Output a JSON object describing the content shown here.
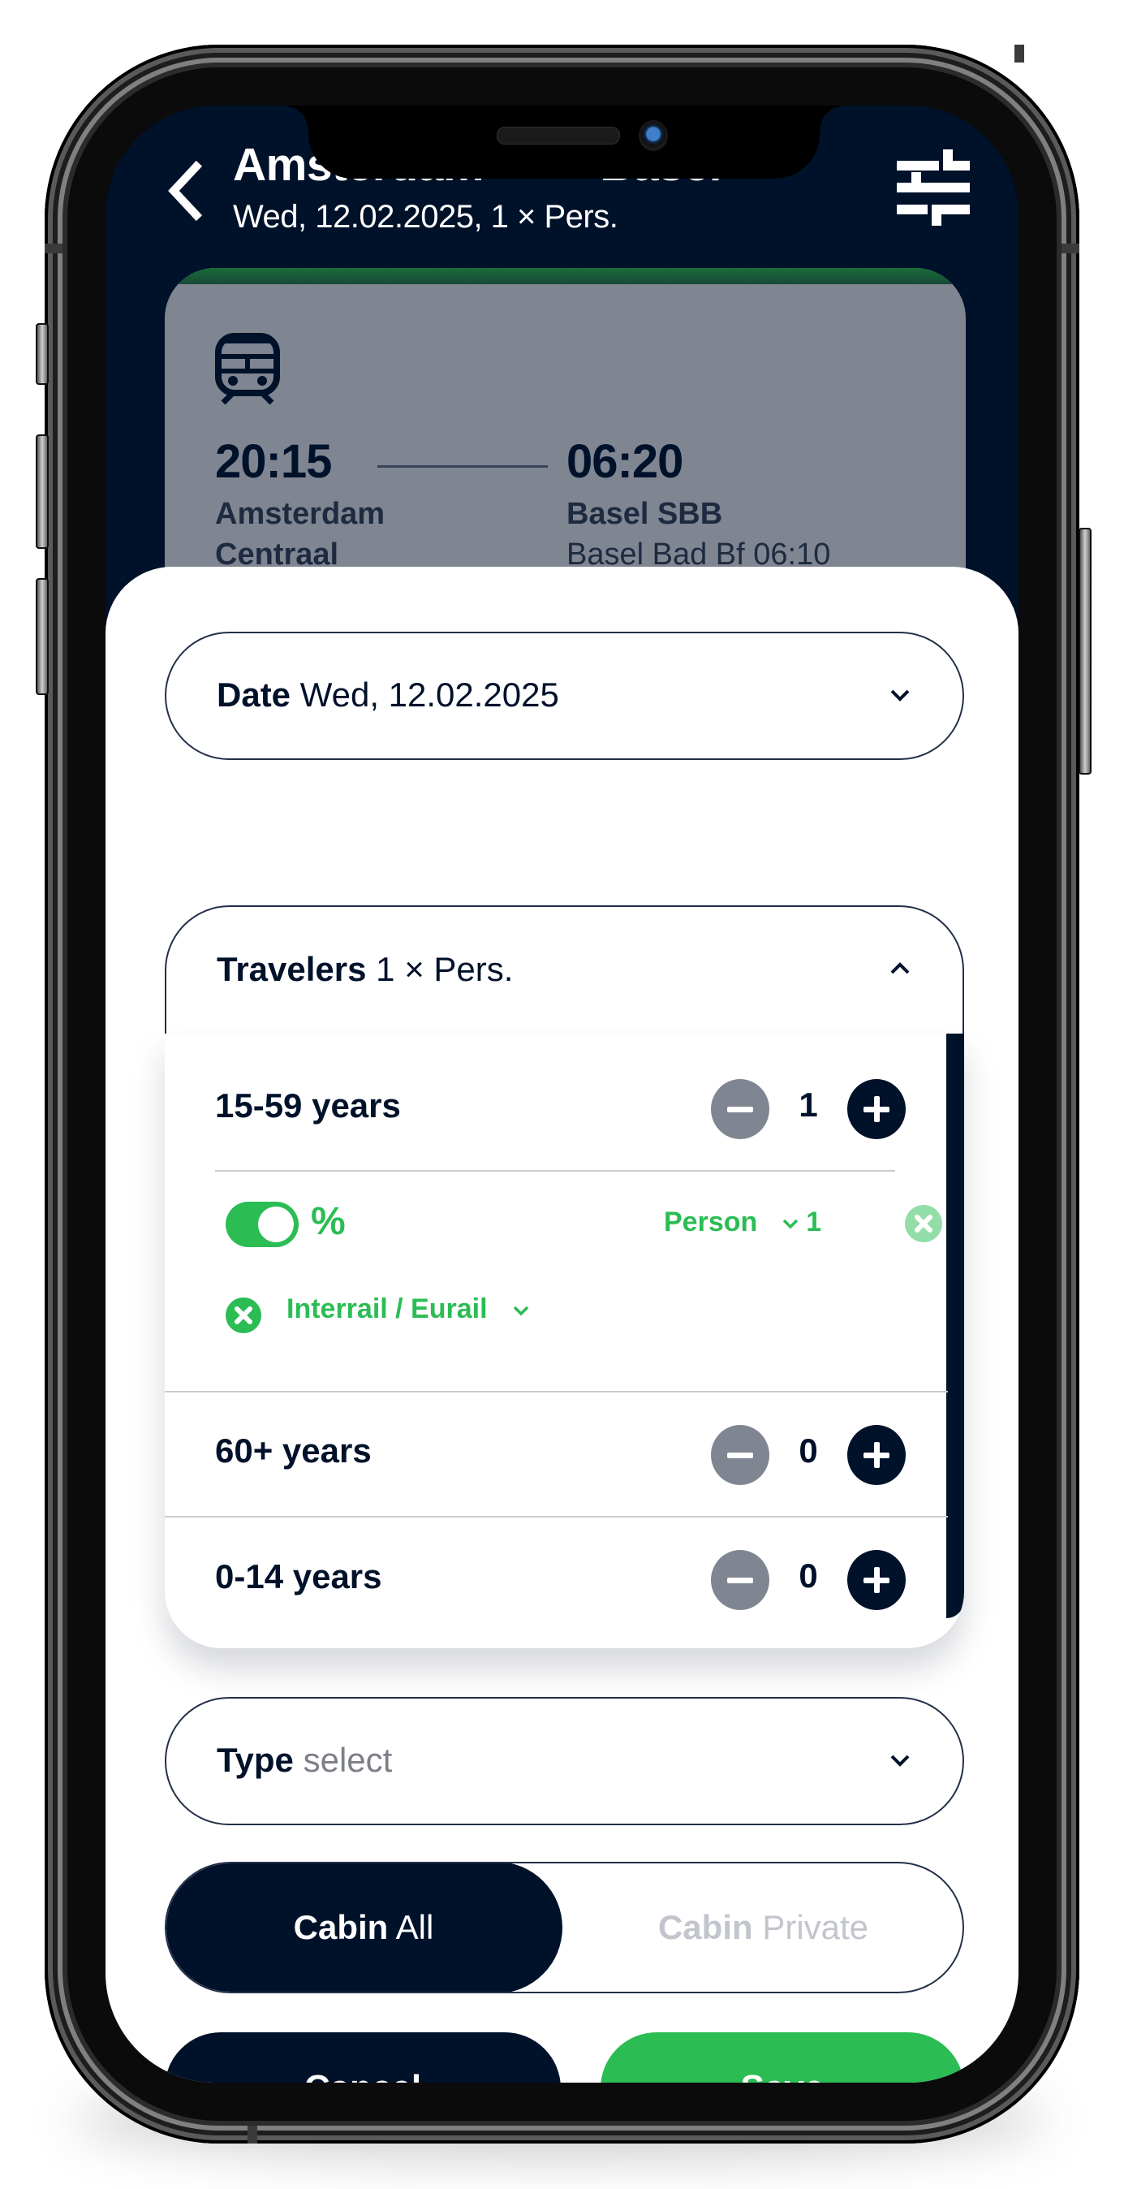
{
  "header": {
    "title_from": "Amsterdam",
    "title_arrow": "→",
    "title_to": "Basel",
    "subtitle": "Wed, 12.02.2025, 1 × Pers.",
    "back_icon": "chevron-left-icon",
    "filter_icon": "sliders-icon"
  },
  "connection": {
    "icon": "train-icon",
    "departure_time": "20:15",
    "arrival_time": "06:20",
    "departure_station_line1": "Amsterdam",
    "departure_station_line2": "Centraal",
    "arrival_station": "Basel SBB",
    "arrival_note": "Basel Bad Bf 06:10"
  },
  "date_field": {
    "label": "Date",
    "value": "Wed, 12.02.2025"
  },
  "travelers": {
    "label": "Travelers",
    "value": "1 × Pers.",
    "groups": [
      {
        "label": "15-59 years",
        "count": "1"
      },
      {
        "label": "60+ years",
        "count": "0"
      },
      {
        "label": "0-14 years",
        "count": "0"
      }
    ],
    "discount": {
      "toggle_on": true,
      "toggle_label": "%",
      "person_select": "Person",
      "person_index": "1",
      "card_name": "Interrail / Eurail"
    }
  },
  "type_field": {
    "label": "Type",
    "placeholder": "select"
  },
  "cabin": {
    "options": [
      {
        "label": "Cabin",
        "value": "All",
        "active": true
      },
      {
        "label": "Cabin",
        "value": "Private",
        "active": false
      }
    ]
  },
  "actions": {
    "cancel": "Cancel",
    "save": "Save"
  },
  "colors": {
    "navy": "#00112a",
    "green": "#2bbd54",
    "gray": "#7f8591"
  }
}
